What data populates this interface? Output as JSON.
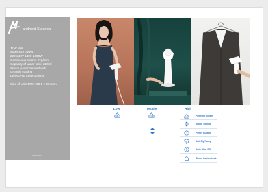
{
  "brand": {
    "name": "andheld Steamer"
  },
  "specs": [
    "YPZ-150",
    "Maximum power:",
    "220-240V  1400-1600W",
    "Continuous steam: 27g/min",
    "Capacity of water tank: 220ml",
    "Steam panel: Heated with",
    "ceramic coating",
    "LE/ME/HE three options"
  ],
  "size_text": "Size of unit: 170 × 92.5 × 264mm",
  "footer_text": "MINIMIST",
  "levels": {
    "low": "Low",
    "middle": "Middle",
    "high": "High"
  },
  "features": [
    {
      "label": "Powerful Steam",
      "icon": "steam-icon"
    },
    {
      "label": "Steam Setting",
      "icon": "up-down-icon"
    },
    {
      "label": "Power Button",
      "icon": "power-icon"
    },
    {
      "label": "Anti-Fly Pump",
      "icon": "shield-icon"
    },
    {
      "label": "Auto Shut Off",
      "icon": "dollar-circle-icon"
    },
    {
      "label": "Steam button Lock",
      "icon": "lock-icon"
    }
  ],
  "colors": {
    "accent": "#2f76c6",
    "sidebar": "#a8a8a8",
    "photo1_bg": "#b6735a",
    "photo2_bg": "#1e4f49",
    "photo3_bg": "#eeeeec"
  }
}
